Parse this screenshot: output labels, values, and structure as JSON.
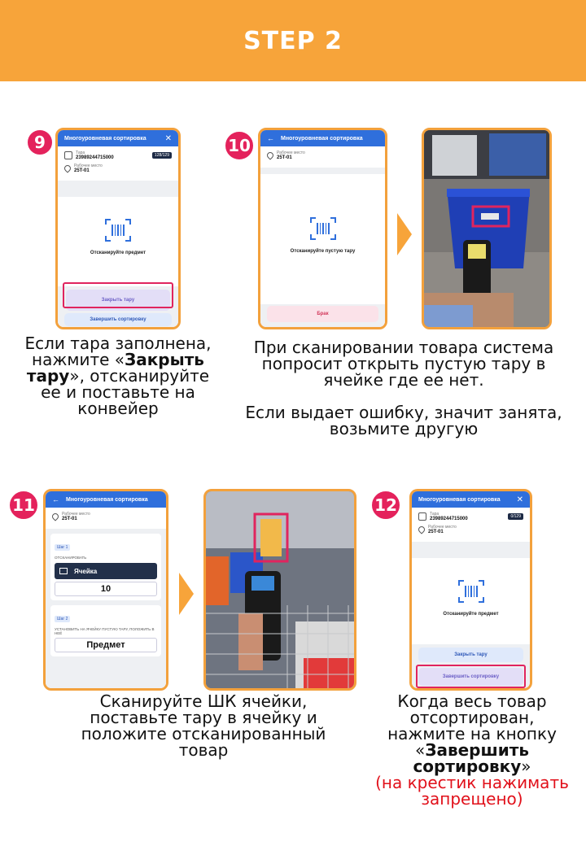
{
  "banner": {
    "title": "STEP 2"
  },
  "colors": {
    "accent": "#f7a43a",
    "badge": "#e4225c",
    "app_blue": "#2f6fdc",
    "highlight": "#e0245e"
  },
  "steps": [
    {
      "number": "9",
      "screen": {
        "header_title": "Многоуровневая сортировка",
        "tara_label": "Тара",
        "tara_value": "23989244715000",
        "tara_badge": "128/129",
        "place_label": "Рабочее место",
        "place_value": "25T-01",
        "scan_text": "Отсканируйте предмет",
        "btn_close": "Закрыть тару",
        "btn_finish": "Завершить сортировку"
      },
      "caption": {
        "pre": "Если тара заполнена, нажмите «",
        "bold": "Закрыть тару",
        "post": "», отсканируйте ее и поставьте на конвейер"
      }
    },
    {
      "number": "10",
      "screen": {
        "header_title": "Многоуровневая сортировка",
        "place_label": "Рабочее место",
        "place_value": "25T-01",
        "scan_text": "Отсканируйте пустую тару",
        "btn_defect": "Брак"
      },
      "caption": {
        "line1": "При сканировании товара система попросит открыть пустую тару в ячейке где ее нет.",
        "line2": "Если выдает ошибку, значит занята, возьмите другую"
      }
    },
    {
      "number": "11",
      "screen": {
        "header_title": "Многоуровневая сортировка",
        "place_label": "Рабочее место",
        "place_value": "25T-01",
        "step1_tag": "Шаг 1",
        "step1_caps": "ОТСКАНИРОВАТЬ",
        "cell_label": "Ячейка",
        "cell_value": "10",
        "step2_tag": "Шаг 2",
        "step2_caps": "УСТАНОВИТЬ НА ЯЧЕЙКУ ПУСТУЮ ТАРУ, ПОЛОЖИТЬ В НЕЁ",
        "item_value": "Предмет"
      },
      "caption": {
        "text": "Сканируйте ШК ячейки, поставьте тару в ячейку и положите отсканированный товар"
      }
    },
    {
      "number": "12",
      "screen": {
        "header_title": "Многоуровневая сортировка",
        "tara_label": "Тара",
        "tara_value": "23989244715000",
        "tara_badge": "0/129",
        "place_label": "Рабочее место",
        "place_value": "25T-01",
        "scan_text": "Отсканируйте предмет",
        "btn_close": "Закрыть тару",
        "btn_finish": "Завершить сортировку"
      },
      "caption": {
        "pre": "Когда весь товар отсортирован, нажмите на кнопку «",
        "bold": "Завершить сортировку",
        "post": "»",
        "warning": "(на крестик нажимать запрещено)"
      }
    }
  ]
}
